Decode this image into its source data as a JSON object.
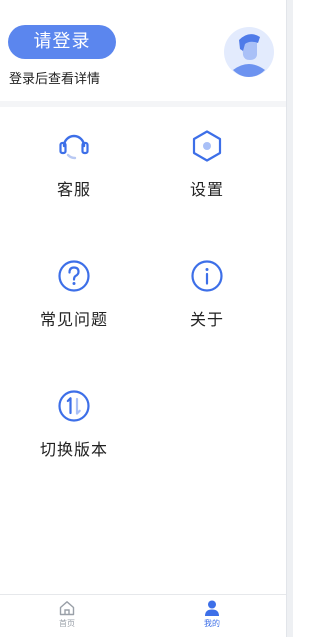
{
  "header": {
    "login_button": "请登录",
    "login_hint": "登录后查看详情"
  },
  "menu": {
    "items": [
      {
        "label": "客服",
        "icon": "headset-icon"
      },
      {
        "label": "设置",
        "icon": "settings-hexagon-icon"
      },
      {
        "label": "常见问题",
        "icon": "question-icon"
      },
      {
        "label": "关于",
        "icon": "info-icon"
      },
      {
        "label": "切换版本",
        "icon": "switch-version-icon"
      }
    ]
  },
  "tabbar": {
    "tabs": [
      {
        "label": "首页",
        "icon": "home-icon",
        "active": false
      },
      {
        "label": "我的",
        "icon": "user-icon",
        "active": true
      }
    ]
  },
  "colors": {
    "accent": "#5b86ee",
    "icon_blue": "#3d6fe8",
    "text": "#222222",
    "inactive": "#9aa0a8"
  }
}
